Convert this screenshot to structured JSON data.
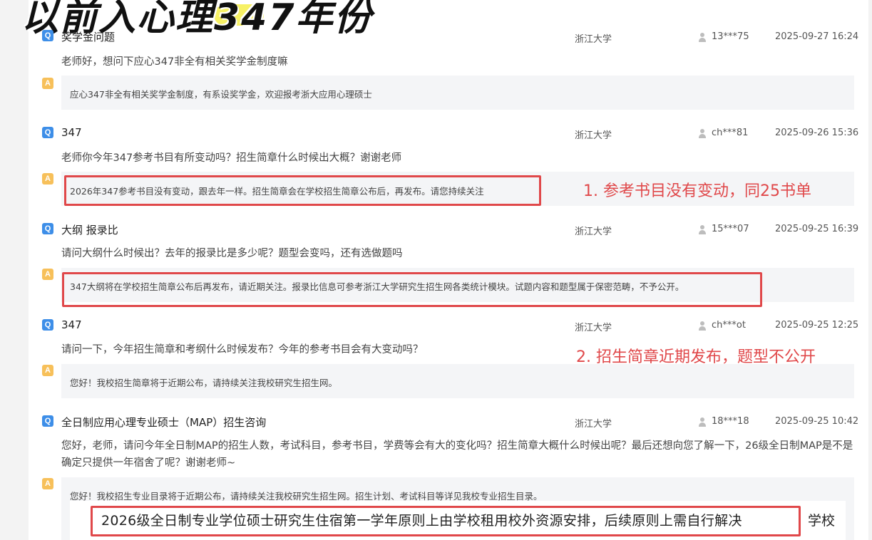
{
  "banner": {
    "title": "以前入心理347年份"
  },
  "items": [
    {
      "title": "奖学金问题",
      "school": "浙江大学",
      "user": "13***75",
      "time": "2025-09-27 16:24",
      "question": "老师好，想问下应心347非全有相关奖学金制度嘛",
      "answer": "应心347非全有相关奖学金制度，有系设奖学金，欢迎报考浙大应用心理硕士"
    },
    {
      "title": "347",
      "school": "浙江大学",
      "user": "ch***81",
      "time": "2025-09-26 15:36",
      "question": "老师你今年347参考书目有所变动吗？招生简章什么时候出大概？谢谢老师",
      "answer": "2026年347参考书目没有变动，跟去年一样。招生简章会在学校招生简章公布后，再发布。请您持续关注"
    },
    {
      "title": "大纲 报录比",
      "school": "浙江大学",
      "user": "15***07",
      "time": "2025-09-25 16:39",
      "question": "请问大纲什么时候出？去年的报录比是多少呢？题型会变吗，还有选做题吗",
      "answer": "347大纲将在学校招生简章公布后再发布，请近期关注。报录比信息可参考浙江大学研究生招生网各类统计模块。试题内容和题型属于保密范畴，不予公开。"
    },
    {
      "title": "347",
      "school": "浙江大学",
      "user": "ch***ot",
      "time": "2025-09-25 12:25",
      "question": "请问一下，今年招生简章和考纲什么时候发布？今年的参考书目会有大变动吗？",
      "answer": "您好！我校招生简章将于近期公布，请持续关注我校研究生招生网。"
    },
    {
      "title": "全日制应用心理专业硕士（MAP）招生咨询",
      "school": "浙江大学",
      "user": "18***18",
      "time": "2025-09-25 10:42",
      "question": "您好，老师，请问今年全日制MAP的招生人数，考试科目，参考书目，学费等会有大的变化吗？招生简章大概什么时候出呢？最后还想向您了解一下，26级全日制MAP是不是确定只提供一年宿舍了呢？谢谢老师~",
      "answer": "您好！我校招生专业目录将于近期公布，请持续关注我校研究生招生网。招生计划、考试科目等详见我校专业招生目录。"
    }
  ],
  "badges": {
    "q": "Q",
    "a": "A"
  },
  "notes": {
    "note1": "1. 参考书目没有变动，同25书单",
    "note2": "2. 招生简章近期发布，题型不公开"
  },
  "big_answer": {
    "text": "2026级全日制专业学位硕士研究生住宿第一学年原则上由学校租用校外资源安排，后续原则上需自行解决",
    "tail": "学校"
  },
  "colors": {
    "accent_blue": "#3d8ee8",
    "answer_badge": "#f7c05a",
    "highlight_red": "#e0484a"
  }
}
